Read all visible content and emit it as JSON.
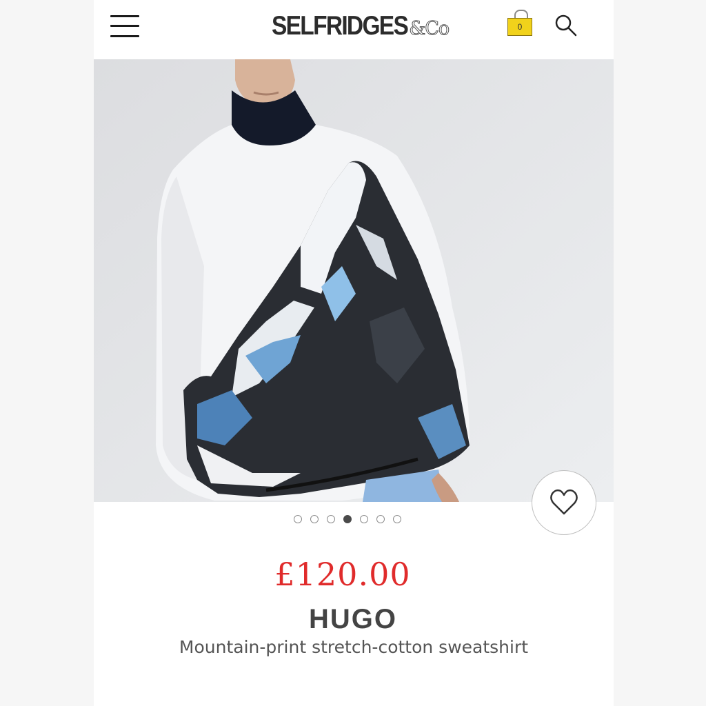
{
  "header": {
    "logo_main": "SELFRIDGES",
    "logo_suffix": "&Co",
    "bag_count": "0",
    "icons": [
      "hamburger-menu-icon",
      "shopping-bag-icon",
      "search-icon"
    ]
  },
  "gallery": {
    "image_count": 7,
    "active_index": 3
  },
  "product": {
    "price": "£120.00",
    "brand": "HUGO",
    "name": "Mountain-print stretch-cotton sweatshirt"
  },
  "colors": {
    "price": "#e02b2b",
    "bag": "#f1d21b",
    "brand_text": "#444444"
  }
}
